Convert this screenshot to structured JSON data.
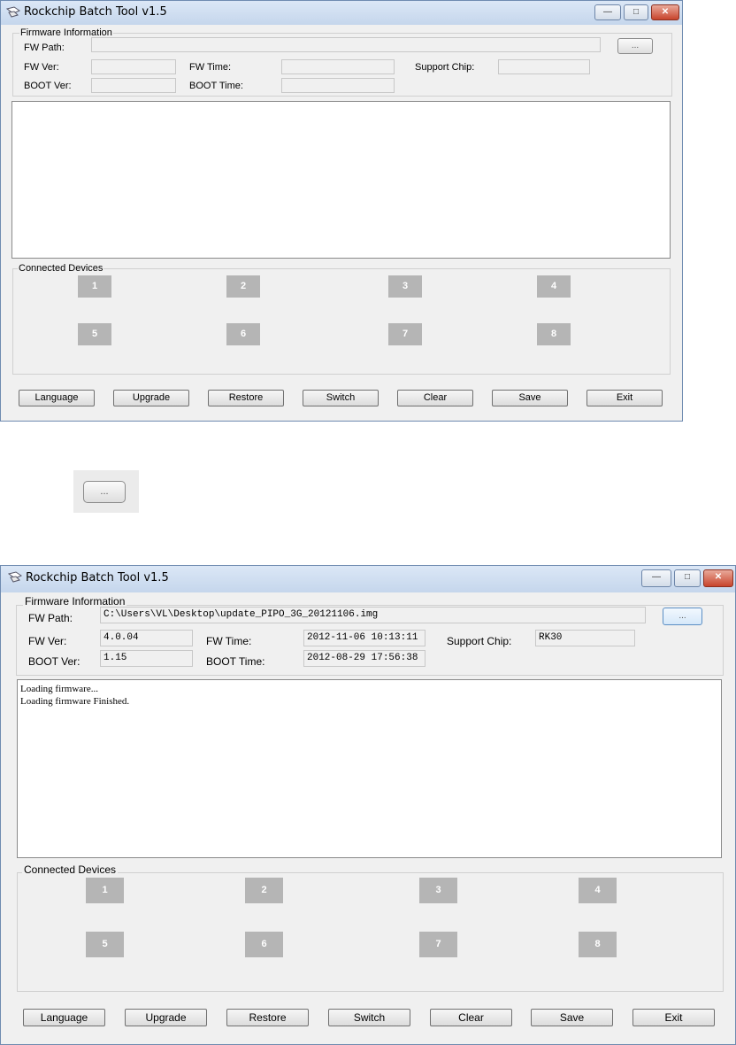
{
  "window1": {
    "title": "Rockchip Batch Tool v1.5",
    "firmware_group": "Firmware Information",
    "fw_path_label": "FW Path:",
    "fw_path_value": "",
    "browse_label": "...",
    "fw_ver_label": "FW Ver:",
    "fw_ver_value": "",
    "fw_time_label": "FW Time:",
    "fw_time_value": "",
    "support_chip_label": "Support Chip:",
    "support_chip_value": "",
    "boot_ver_label": "BOOT Ver:",
    "boot_ver_value": "",
    "boot_time_label": "BOOT Time:",
    "boot_time_value": "",
    "log_text": "",
    "devices_group": "Connected Devices"
  },
  "middle_button": {
    "label": "..."
  },
  "window2": {
    "title": "Rockchip Batch Tool v1.5",
    "firmware_group": "Firmware Information",
    "fw_path_label": "FW Path:",
    "fw_path_value": "C:\\Users\\VL\\Desktop\\update_PIPO_3G_20121106.img",
    "browse_label": "...",
    "fw_ver_label": "FW Ver:",
    "fw_ver_value": "4.0.04",
    "fw_time_label": "FW Time:",
    "fw_time_value": "2012-11-06 10:13:11",
    "support_chip_label": "Support Chip:",
    "support_chip_value": "RK30",
    "boot_ver_label": "BOOT Ver:",
    "boot_ver_value": "1.15",
    "boot_time_label": "BOOT Time:",
    "boot_time_value": "2012-08-29 17:56:38",
    "log_text": "Loading firmware...\nLoading firmware Finished.",
    "devices_group": "Connected Devices"
  },
  "devices": [
    "1",
    "2",
    "3",
    "4",
    "5",
    "6",
    "7",
    "8"
  ],
  "buttons": [
    "Language",
    "Upgrade",
    "Restore",
    "Switch",
    "Clear",
    "Save",
    "Exit"
  ],
  "window_controls": {
    "minimize": "—",
    "maximize": "□",
    "close": "✕"
  },
  "colors": {
    "device_slot": "#b5b5b5",
    "titlebar": "#c5d6ec",
    "close": "#c8442c"
  }
}
